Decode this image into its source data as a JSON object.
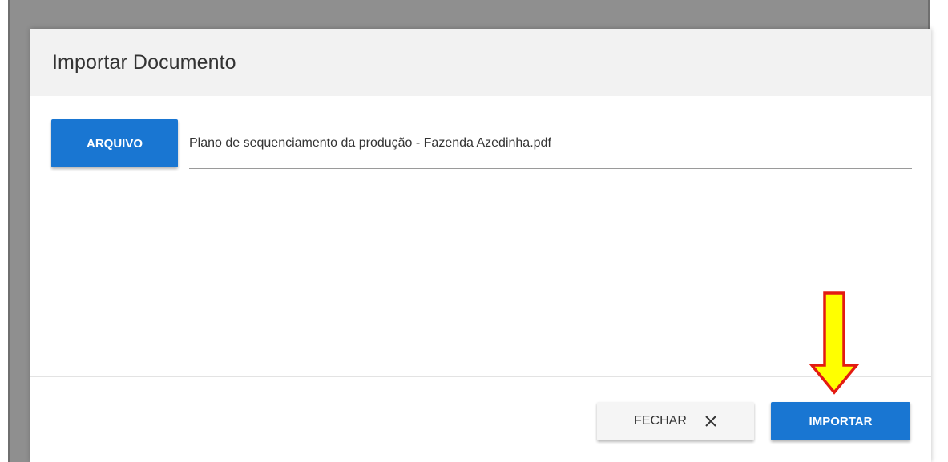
{
  "dialog": {
    "title": "Importar Documento"
  },
  "file_picker": {
    "button_label": "ARQUIVO",
    "selected_file": "Plano de sequenciamento da produção - Fazenda Azedinha.pdf"
  },
  "footer": {
    "close_label": "FECHAR",
    "close_icon": "close-icon",
    "import_label": "IMPORTAR"
  },
  "annotation": {
    "arrow_icon": "down-arrow-icon"
  },
  "colors": {
    "primary": "#1976d2",
    "header_bg": "#f2f2f2",
    "backdrop": "#8f8f8f",
    "arrow_fill": "#ffff00",
    "arrow_stroke": "#e31b12"
  }
}
